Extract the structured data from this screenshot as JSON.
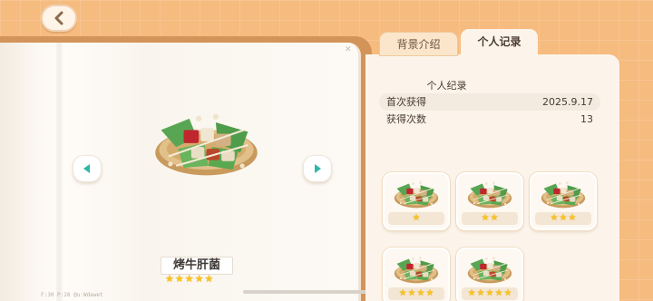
{
  "header": {
    "back_icon": "chevron-left-icon"
  },
  "tabs": [
    {
      "label": "背景介绍",
      "active": false
    },
    {
      "label": "个人记录",
      "active": true
    }
  ],
  "book": {
    "item_name": "烤牛肝菌",
    "rarity_stars": 5,
    "debug_overlay": "F:30  P:28  @u:Wdawet",
    "prev_icon": "triangle-left-icon",
    "next_icon": "triangle-right-icon"
  },
  "record": {
    "title": "个人纪录",
    "rows": [
      {
        "label": "首次获得",
        "value": "2025.9.17"
      },
      {
        "label": "获得次数",
        "value": "13"
      }
    ]
  },
  "variants": [
    {
      "stars": 1
    },
    {
      "stars": 2
    },
    {
      "stars": 3
    },
    {
      "stars": 4
    },
    {
      "stars": 5
    }
  ],
  "colors": {
    "background": "#f6bb7f",
    "panel": "#fcf4ea",
    "star": "#f8c421",
    "accent_teal": "#2eb7a8"
  }
}
